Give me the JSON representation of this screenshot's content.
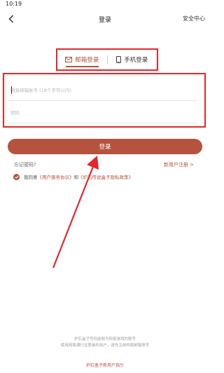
{
  "status_bar": {
    "time": "10:19"
  },
  "nav": {
    "title": "登录",
    "right_label": "安全中心"
  },
  "tabs": [
    {
      "label": "邮箱登录",
      "icon": "mail-icon",
      "active": true
    },
    {
      "label": "手机登录",
      "icon": "phone-icon",
      "active": false
    }
  ],
  "form": {
    "email_placeholder": "网易邮箱账号 (18个字符以内)",
    "password_placeholder": "密码"
  },
  "login_button": "登录",
  "links": {
    "forgot": "忘记密码?",
    "register": "新用户注册 >"
  },
  "agreement": {
    "prefix": "我同意",
    "terms": "《用户服务协议》",
    "and": "和",
    "privacy": "《炉石传说盒子隐私政策》"
  },
  "footer": {
    "line1": "炉石盒子号码能够为网易游戏的账号",
    "line2": "使用网易通行证登录的用户，请先注册网易邮箱账号",
    "link": "炉石盒子新用户指引"
  },
  "colors": {
    "accent": "#b5533f",
    "highlight": "#e8262b"
  }
}
